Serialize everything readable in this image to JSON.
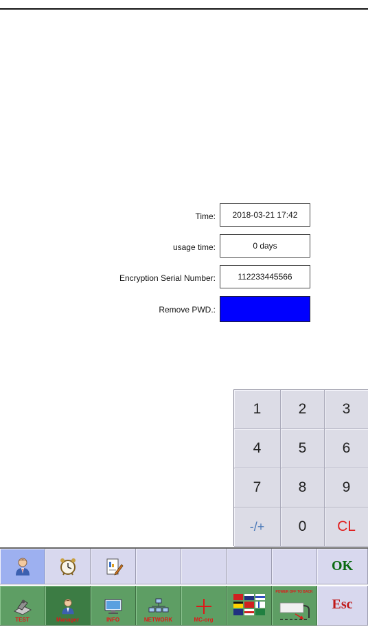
{
  "settings_form": {
    "time_label": "Time:",
    "time_value": "2018-03-21 17:42",
    "usage_label": "usage time:",
    "usage_value": "0 days",
    "serial_label": "Encryption Serial Number:",
    "serial_value": "112233445566",
    "remove_pwd_label": "Remove PWD.:",
    "remove_pwd_color": "#0000ff"
  },
  "keypad": {
    "keys": [
      "1",
      "2",
      "3",
      "4",
      "5",
      "6",
      "7",
      "8",
      "9",
      "-/+",
      "0",
      "CL"
    ]
  },
  "toolbar_top": {
    "selected_icon": "user-icon",
    "icons": [
      "user-icon",
      "alarm-clock-icon",
      "document-edit-icon"
    ],
    "ok_label": "OK"
  },
  "toolbar_bottom": {
    "tabs": [
      "TEST",
      "Manager",
      "INFO",
      "NETWORK",
      "MC-org"
    ],
    "active_tab": "Manager",
    "language_icon": "flags-icon",
    "power_off_text": "POWER OFF TO BACK",
    "esc_label": "Esc"
  },
  "colors": {
    "accent_green": "#5e9e64",
    "selected_blue": "#9db0f0",
    "ok_green": "#0a6a12",
    "esc_red": "#c01818",
    "clear_red": "#e02020"
  }
}
